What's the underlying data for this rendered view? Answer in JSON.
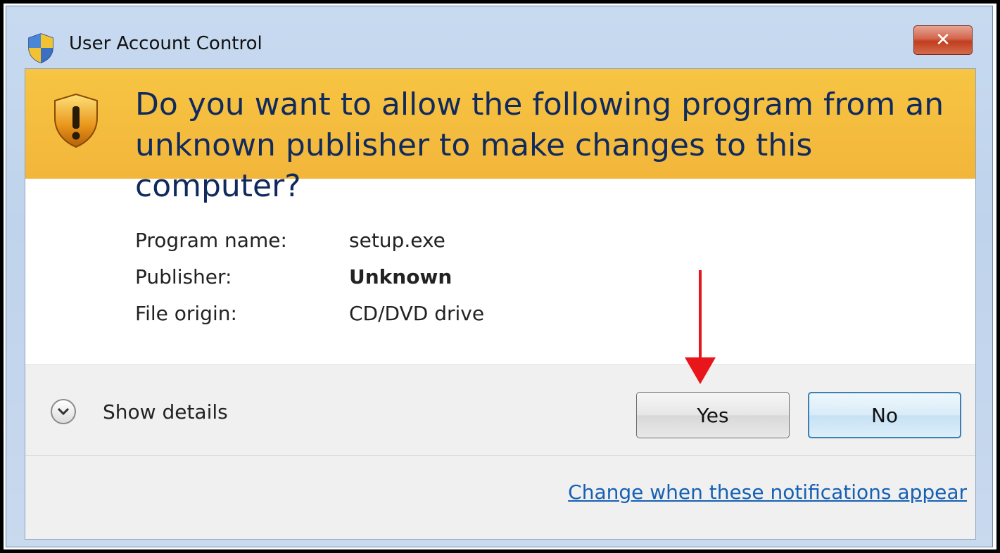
{
  "window": {
    "title": "User Account Control",
    "close_label": "✕"
  },
  "banner": {
    "question": "Do you want to allow the following program from an unknown publisher to make changes to this computer?"
  },
  "details": {
    "rows": [
      {
        "label": "Program name:",
        "value": "setup.exe"
      },
      {
        "label": "Publisher:",
        "value": "Unknown"
      },
      {
        "label": "File origin:",
        "value": "CD/DVD drive"
      }
    ]
  },
  "footer": {
    "show_details_label": "Show details",
    "yes_label": "Yes",
    "no_label": "No",
    "change_link": "Change when these notifications appear"
  },
  "colors": {
    "banner": "#f2b63a",
    "question_text": "#102a5e",
    "link": "#1660b3",
    "annotation_arrow": "#e8161b"
  },
  "icons": {
    "title": "uac-shield-icon",
    "banner": "warning-shield-icon",
    "show_details": "chevron-down-icon",
    "annotation": "red-arrow-icon"
  }
}
